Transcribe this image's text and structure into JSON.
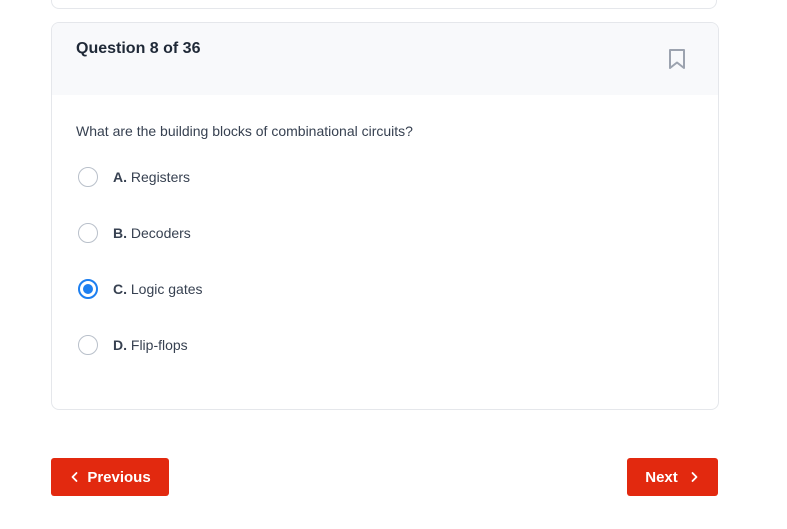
{
  "question": {
    "header": "Question 8 of 36",
    "text": "What are the building blocks of combinational circuits?",
    "options": [
      {
        "letter": "A.",
        "text": "Registers",
        "selected": false
      },
      {
        "letter": "B.",
        "text": "Decoders",
        "selected": false
      },
      {
        "letter": "C.",
        "text": "Logic gates",
        "selected": true
      },
      {
        "letter": "D.",
        "text": "Flip-flops",
        "selected": false
      }
    ]
  },
  "navigation": {
    "previous_label": "Previous",
    "next_label": "Next"
  },
  "icons": {
    "bookmark": "bookmark-icon",
    "previous": "chevron-left-icon",
    "next": "chevron-right-icon"
  },
  "colors": {
    "accent": "#1d7ff0",
    "button": "#e2290f"
  }
}
